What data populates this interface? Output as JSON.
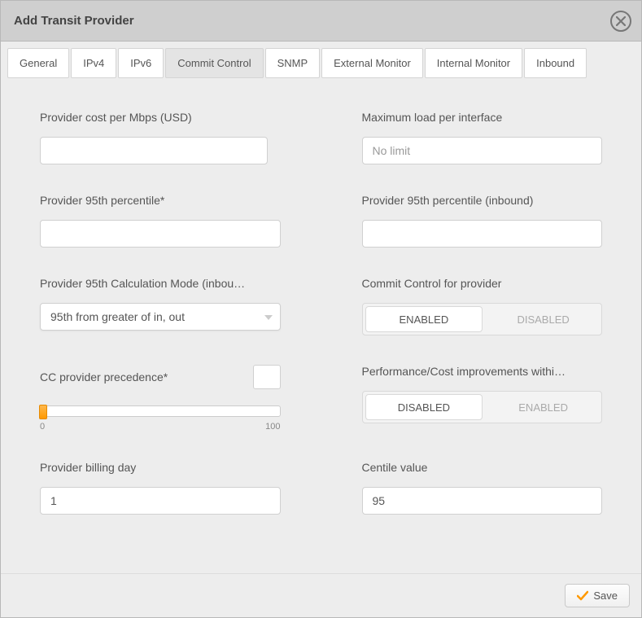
{
  "dialog": {
    "title": "Add Transit Provider"
  },
  "tabs": [
    {
      "label": "General"
    },
    {
      "label": "IPv4"
    },
    {
      "label": "IPv6"
    },
    {
      "label": "Commit Control"
    },
    {
      "label": "SNMP"
    },
    {
      "label": "External Monitor"
    },
    {
      "label": "Internal Monitor"
    },
    {
      "label": "Inbound"
    }
  ],
  "fields": {
    "cost": {
      "label": "Provider cost per Mbps (USD)",
      "value": ""
    },
    "maxload": {
      "label": "Maximum load per interface",
      "placeholder": "No limit",
      "value": ""
    },
    "p95": {
      "label": "Provider 95th percentile*",
      "value": ""
    },
    "p95in": {
      "label": "Provider 95th percentile (inbound)",
      "value": ""
    },
    "calcmode": {
      "label": "Provider 95th Calculation Mode (inbou…",
      "value": "95th from greater of in, out"
    },
    "commit": {
      "label": "Commit Control for provider",
      "opt1": "ENABLED",
      "opt2": "DISABLED"
    },
    "precedence": {
      "label": "CC provider precedence*",
      "value": "",
      "min": "0",
      "max": "100"
    },
    "perfcost": {
      "label": "Performance/Cost improvements withi…",
      "opt1": "DISABLED",
      "opt2": "ENABLED"
    },
    "billing": {
      "label": "Provider billing day",
      "value": "1"
    },
    "centile": {
      "label": "Centile value",
      "value": "95"
    }
  },
  "footer": {
    "save": "Save"
  }
}
